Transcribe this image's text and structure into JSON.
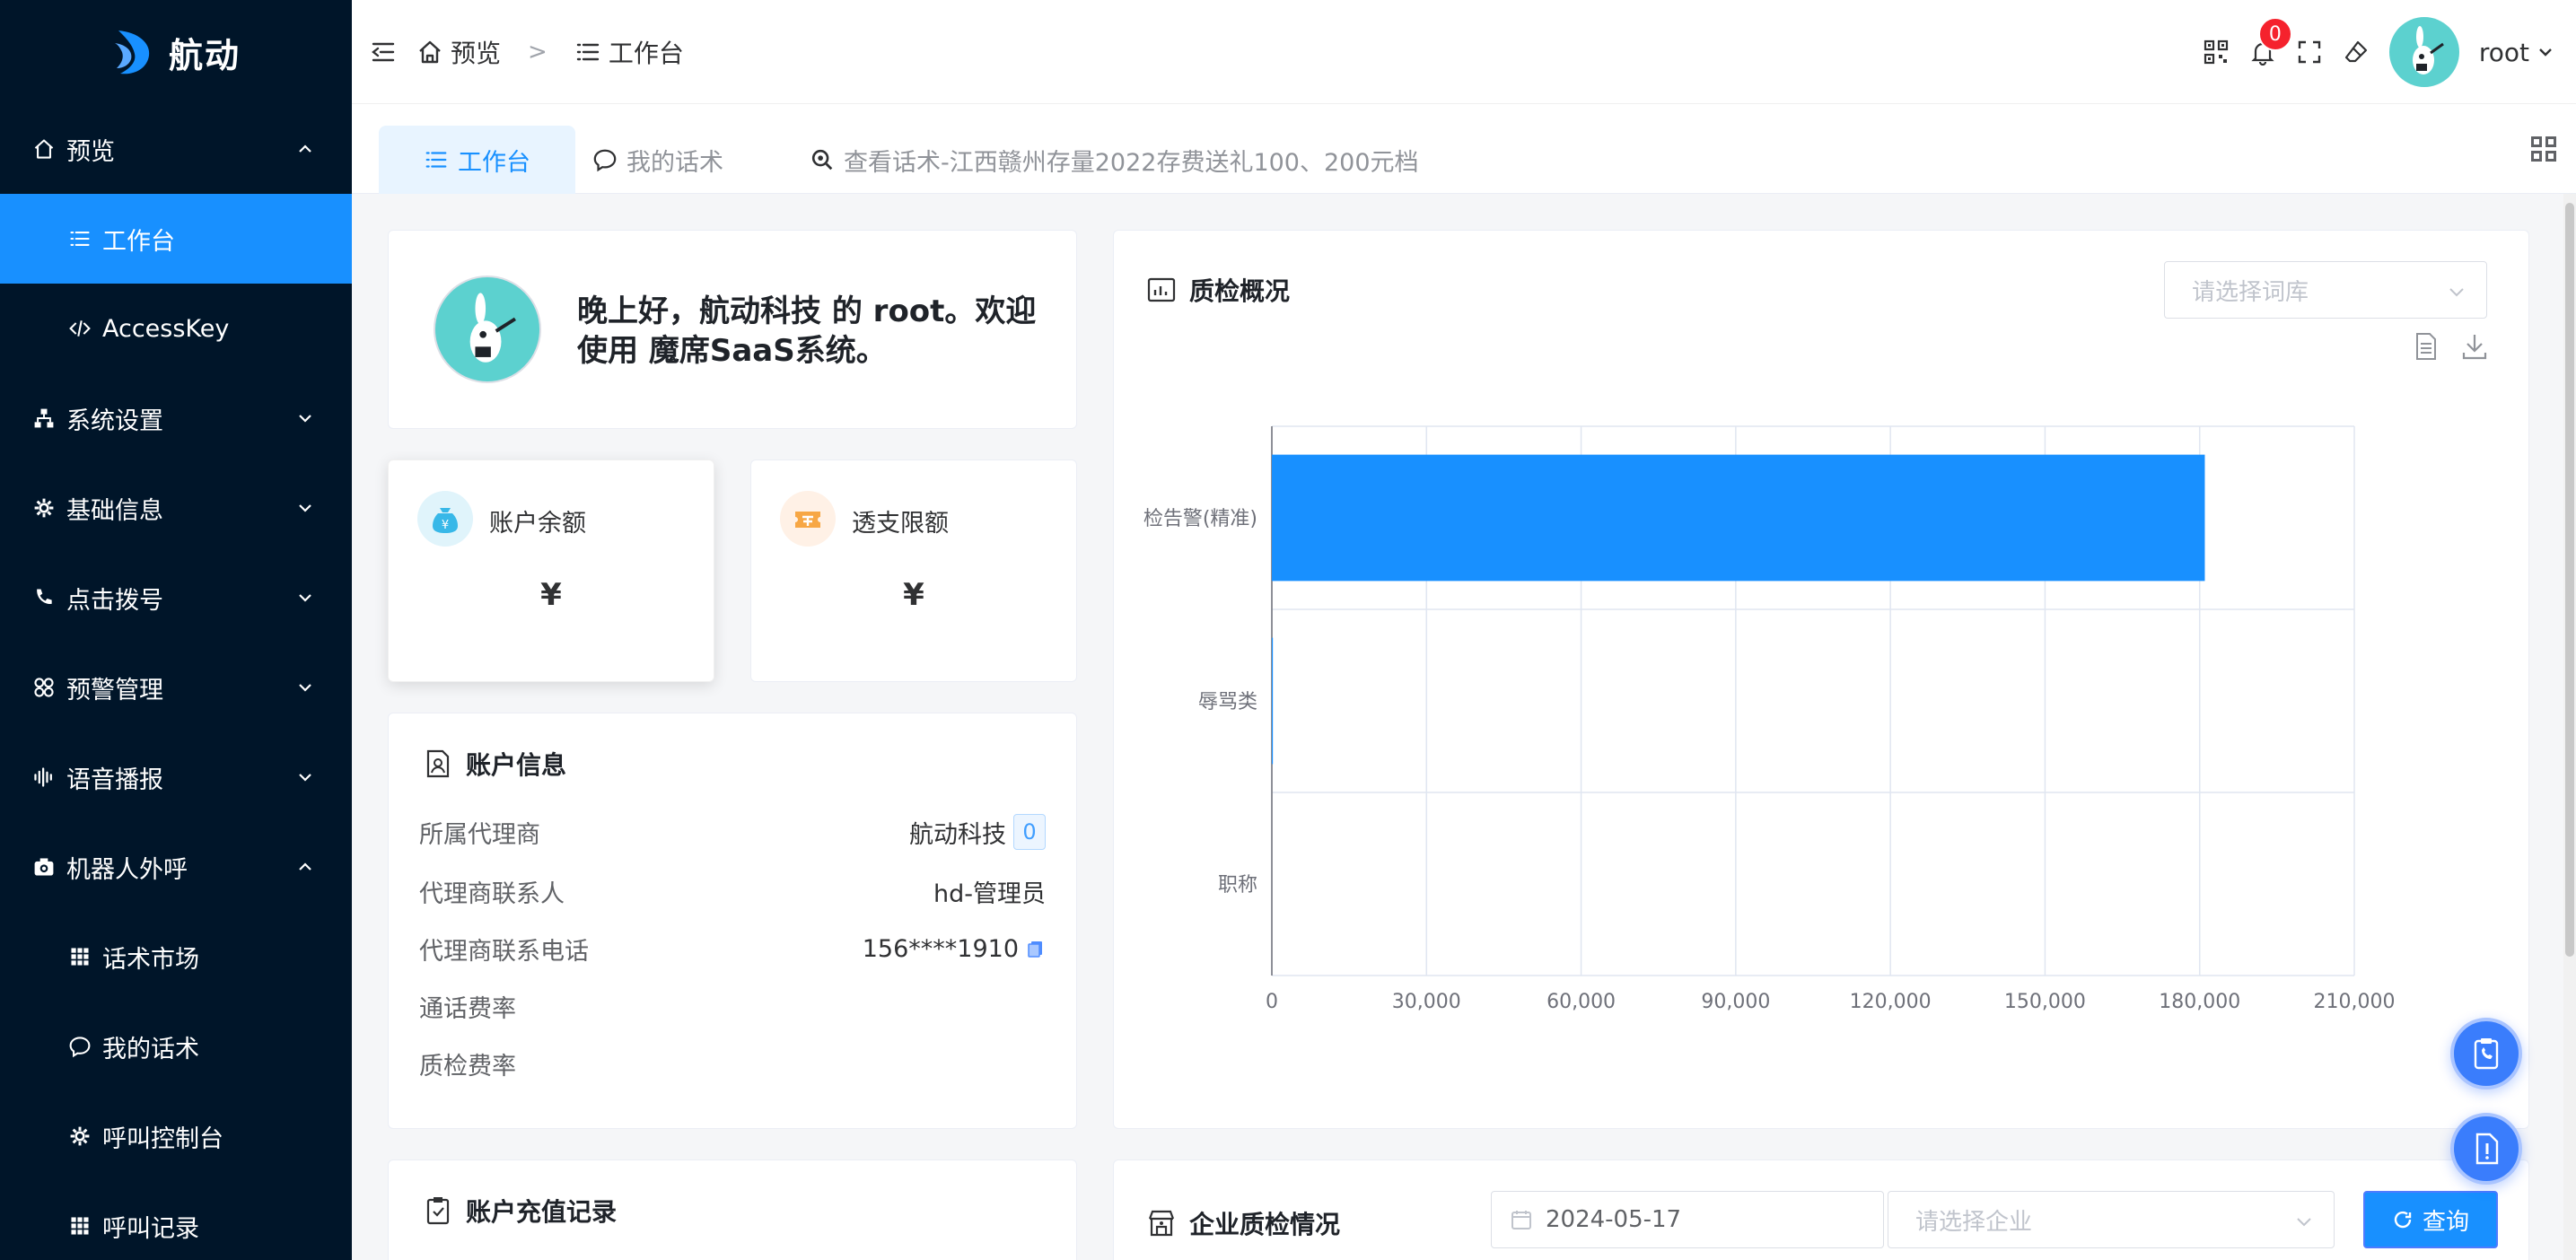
{
  "app": {
    "name": "航动"
  },
  "sidebar": {
    "items": [
      {
        "label": "预览",
        "icon": "home-icon",
        "expanded": true
      },
      {
        "label": "工作台",
        "icon": "list-icon",
        "sub": true,
        "active": true
      },
      {
        "label": "AccessKey",
        "icon": "code-icon",
        "sub": true
      },
      {
        "label": "系统设置",
        "icon": "sitemap-icon"
      },
      {
        "label": "基础信息",
        "icon": "gear-icon"
      },
      {
        "label": "点击拨号",
        "icon": "phone-icon"
      },
      {
        "label": "预警管理",
        "icon": "grid-circles-icon"
      },
      {
        "label": "语音播报",
        "icon": "waveform-icon"
      },
      {
        "label": "机器人外呼",
        "icon": "camera-icon",
        "expanded": true
      },
      {
        "label": "话术市场",
        "icon": "apps-icon",
        "sub": true
      },
      {
        "label": "我的话术",
        "icon": "chat-icon",
        "sub": true
      },
      {
        "label": "呼叫控制台",
        "icon": "gear-icon",
        "sub": true
      },
      {
        "label": "呼叫记录",
        "icon": "apps-icon",
        "sub": true
      }
    ]
  },
  "header": {
    "breadcrumb": [
      "预览",
      "工作台"
    ],
    "breadcrumb_sep": ">",
    "notification_count": "0",
    "user": "root"
  },
  "tabs": [
    {
      "label": "工作台",
      "active": true
    },
    {
      "label": "我的话术"
    },
    {
      "label": "查看话术-江西赣州存量2022存费送礼100、200元档"
    }
  ],
  "welcome": {
    "message": "晚上好，航动科技 的 root。欢迎使用 魔席SaaS系统。"
  },
  "balance": {
    "title": "账户余额",
    "value": "¥"
  },
  "overdraft": {
    "title": "透支限额",
    "value": "¥"
  },
  "account": {
    "title": "账户信息",
    "rows": [
      {
        "key": "所属代理商",
        "value": "航动科技",
        "tag": "0"
      },
      {
        "key": "代理商联系人",
        "value": "hd-管理员"
      },
      {
        "key": "代理商联系电话",
        "value": "156****1910"
      },
      {
        "key": "通话费率",
        "value": ""
      },
      {
        "key": "质检费率",
        "value": ""
      }
    ]
  },
  "recharge": {
    "title": "账户充值记录"
  },
  "quality": {
    "title": "质检概况",
    "select_placeholder": "请选择词库"
  },
  "company": {
    "title": "企业质检情况",
    "date": "2024-05-17",
    "company_placeholder": "请选择企业",
    "query_label": "查询"
  },
  "colors": {
    "primary": "#1890ff",
    "sidebar": "#001529",
    "bar": "#1890ff"
  },
  "chart_data": {
    "type": "bar",
    "orientation": "horizontal",
    "categories": [
      "检告警(精准)",
      "辱骂类",
      "职称"
    ],
    "values": [
      181000,
      200,
      0
    ],
    "xlim": [
      0,
      210000
    ],
    "xticks": [
      "0",
      "30,000",
      "60,000",
      "90,000",
      "120,000",
      "150,000",
      "180,000",
      "210,000"
    ],
    "grid": true
  }
}
